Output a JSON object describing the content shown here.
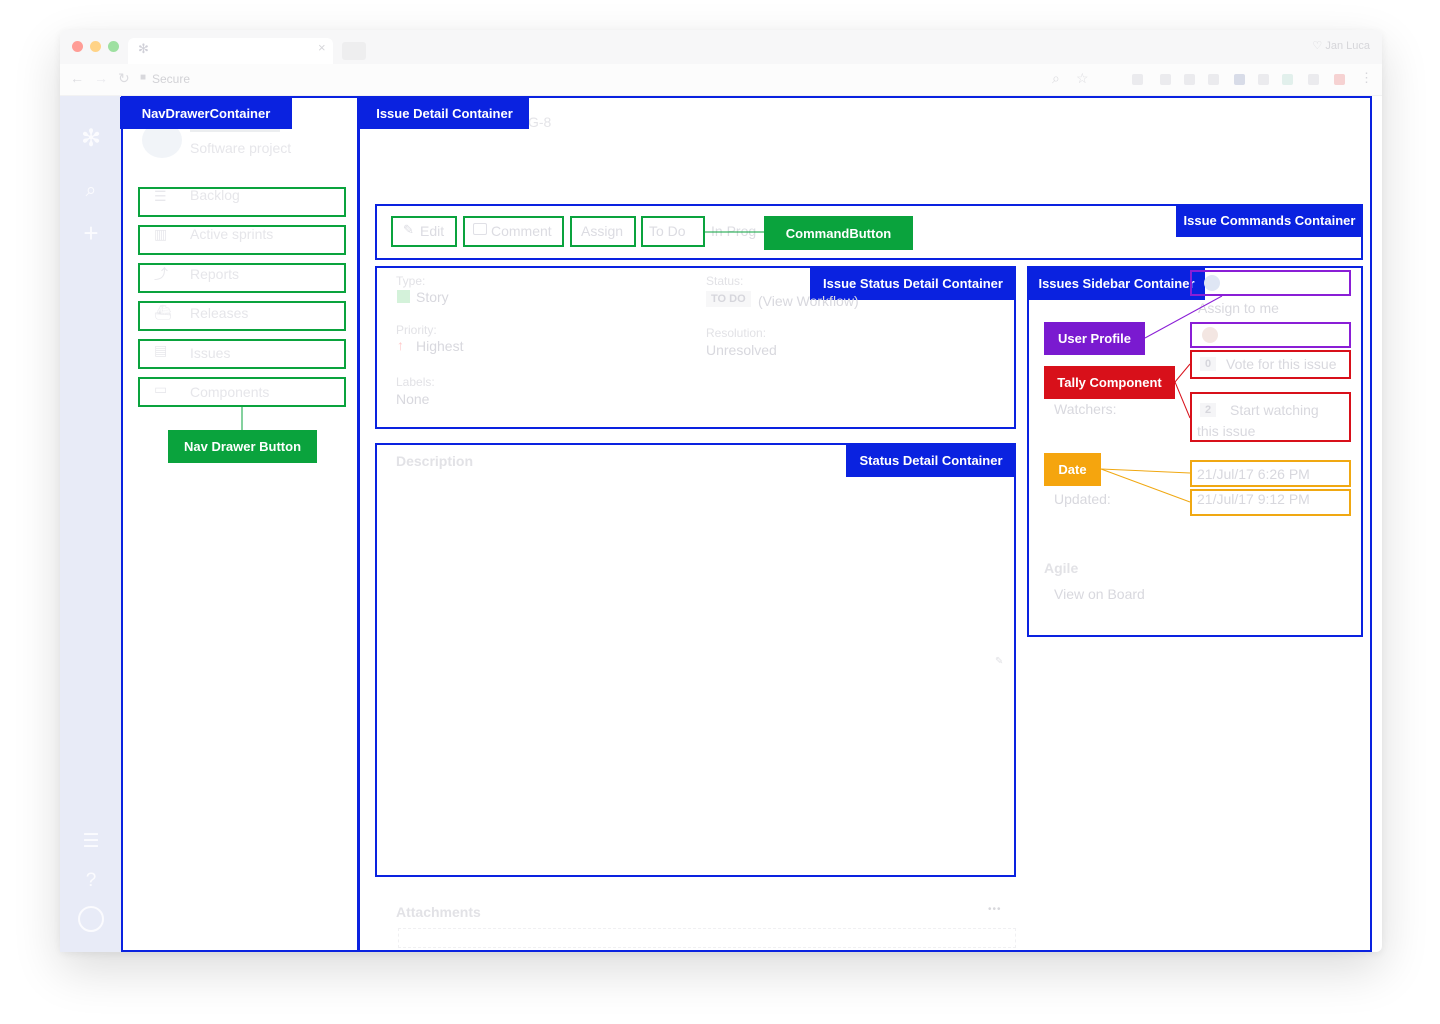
{
  "browser": {
    "address_text": "Secure",
    "profile_name": "Jan Luca",
    "traffic_colors": [
      "#ff9d96",
      "#ffd387",
      "#9ee0a1"
    ]
  },
  "colors": {
    "container": "#0a22e0",
    "nav_button": "#0aa33d",
    "user_profile": "#7a1ad0",
    "tally": "#d8101a",
    "date": "#f5a50e"
  },
  "annotations": {
    "nav_drawer_container": "NavDrawerContainer",
    "issue_detail_container": "Issue Detail Container",
    "issue_commands_container": "Issue Commands Container",
    "command_button": "CommandButton",
    "issue_status_detail_container": "Issue Status Detail Container",
    "issues_sidebar_container": "Issues Sidebar Container",
    "status_detail_container": "Status Detail Container",
    "nav_drawer_button": "Nav Drawer Button",
    "user_profile": "User Profile",
    "tally_component": "Tally Component",
    "date": "Date"
  },
  "project": {
    "subtitle": "Software project",
    "issue_key_fragment": "G-8"
  },
  "nav_items": [
    "Backlog",
    "Active sprints",
    "Reports",
    "Releases",
    "Issues",
    "Components"
  ],
  "commands": {
    "edit": "Edit",
    "comment": "Comment",
    "assign": "Assign",
    "todo": "To Do",
    "in_progress_fragment": "In Prog"
  },
  "details": {
    "type_label": "Type:",
    "type_value": "Story",
    "priority_label": "Priority:",
    "priority_value": "Highest",
    "labels_label": "Labels:",
    "labels_value": "None",
    "status_label": "Status:",
    "status_value": "TO DO",
    "view_workflow": "(View Workflow)",
    "resolution_label": "Resolution:",
    "resolution_value": "Unresolved"
  },
  "description_heading": "Description",
  "attachments_heading": "Attachments",
  "attachments_more": "•••",
  "sidebar": {
    "assign_to_me": "Assign to me",
    "votes_count": "0",
    "votes_text": "Vote for this issue",
    "watchers_label": "Watchers:",
    "watchers_count": "2",
    "watchers_text_1": "Start watching",
    "watchers_text_2": "this issue",
    "created_value": "21/Jul/17 6:26 PM",
    "updated_label": "Updated:",
    "updated_value": "21/Jul/17 9:12 PM",
    "agile_heading": "Agile",
    "view_on_board": "View on Board"
  }
}
